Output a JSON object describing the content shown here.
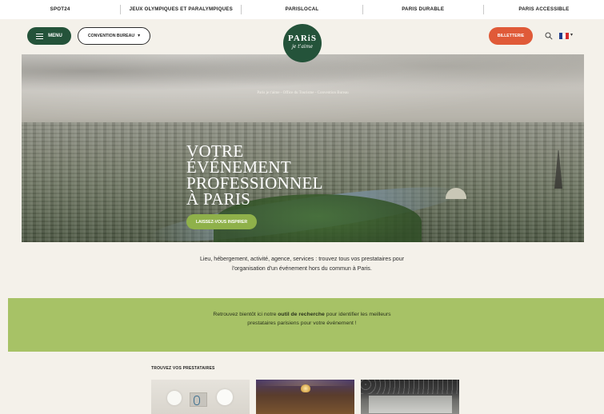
{
  "topnav": {
    "items": [
      "SPOT24",
      "JEUX OLYMPIQUES ET PARALYMPIQUES",
      "PARISLOCAL",
      "PARIS DURABLE",
      "PARIS ACCESSIBLE"
    ]
  },
  "header": {
    "menu_label": "MENU",
    "convention_label": "CONVENTION BUREAU",
    "logo_main": "PARiS",
    "logo_sub": "je t'aime",
    "tickets_label": "BILLETTERIE",
    "flag_colors": [
      "#1f3c8c",
      "#ffffff",
      "#d52b2b"
    ]
  },
  "hero": {
    "breadcrumb": "Paris je t'aime - Office du Tourisme - Convention Bureau",
    "title_lines": [
      "VOTRE",
      "ÉVÉNEMENT",
      "PROFESSIONNEL",
      "À PARIS"
    ],
    "cta_label": "LAISSEZ-VOUS INSPIRER"
  },
  "intro": {
    "text": "Lieu, hébergement, activité, agence, services : trouvez tous vos prestataires pour l'organisation d'un événement hors du commun à Paris."
  },
  "band": {
    "text_before": "Retrouvez bientôt ici notre ",
    "text_bold": "outil de recherche",
    "text_after": " pour identifier les meilleurs prestataires parisiens pour votre événement !"
  },
  "providers": {
    "title": "TROUVEZ VOS PRESTATAIRES"
  },
  "colors": {
    "brand_green": "#24533a",
    "accent_orange": "#e05a38",
    "band_green": "#a7c266",
    "cta_green": "#8fb14a"
  }
}
